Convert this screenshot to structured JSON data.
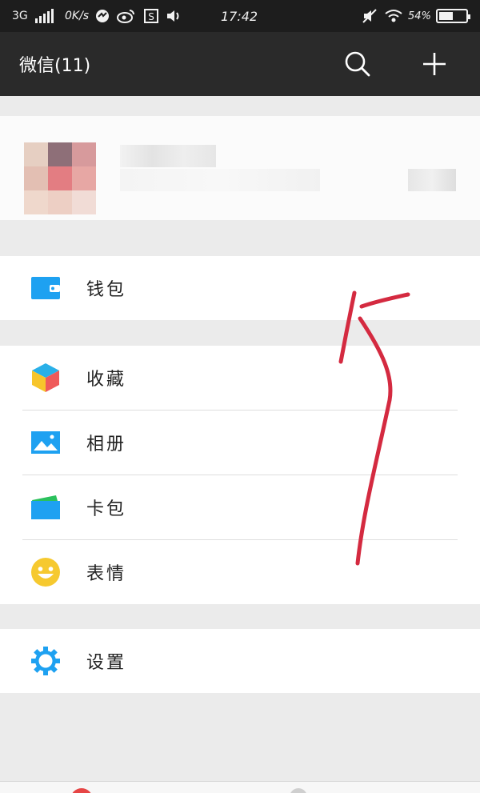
{
  "status_bar": {
    "network": "3G",
    "speed": "0K/s",
    "time": "17:42",
    "battery_percent": "54%",
    "battery_level": 0.54
  },
  "app_bar": {
    "title": "微信(11)",
    "icons": [
      "search-icon",
      "add-icon"
    ]
  },
  "menu": {
    "wallet": {
      "label": "钱包",
      "icon": "wallet-icon"
    },
    "favorites": {
      "label": "收藏",
      "icon": "cube-icon"
    },
    "album": {
      "label": "相册",
      "icon": "image-icon"
    },
    "cards": {
      "label": "卡包",
      "icon": "card-icon"
    },
    "stickers": {
      "label": "表情",
      "icon": "smiley-icon"
    },
    "settings": {
      "label": "设置",
      "icon": "gear-icon"
    }
  },
  "colors": {
    "statusbar_bg": "#1d1d1d",
    "appbar_bg": "#2a2a2a",
    "page_bg": "#ebebeb",
    "icon_blue": "#1ea1f1",
    "annotation_red": "#d42a40"
  }
}
